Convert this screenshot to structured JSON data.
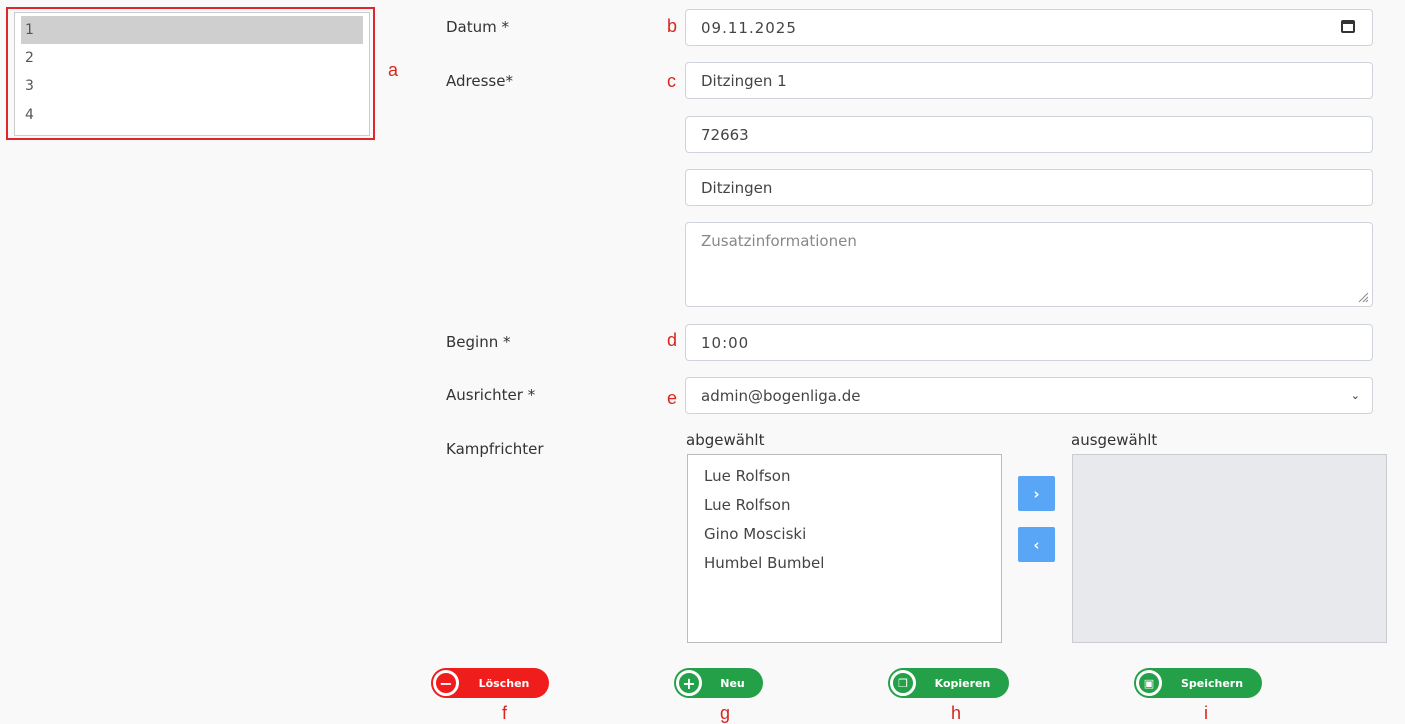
{
  "sidebar": {
    "items": [
      "1",
      "2",
      "3",
      "4"
    ],
    "selected_index": 0
  },
  "annotations": {
    "a": "a",
    "b": "b",
    "c": "c",
    "d": "d",
    "e": "e",
    "f": "f",
    "g": "g",
    "h": "h",
    "i": "i"
  },
  "form": {
    "datum_label": "Datum *",
    "datum_value": "09.11.2025",
    "adresse_label": "Adresse*",
    "street_value": "Ditzingen 1",
    "zip_value": "72663",
    "city_value": "Ditzingen",
    "zusatz_placeholder": "Zusatzinformationen",
    "beginn_label": "Beginn *",
    "beginn_value": "10:00",
    "ausrichter_label": "Ausrichter *",
    "ausrichter_value": "admin@bogenliga.de",
    "kampfrichter_label": "Kampfrichter",
    "abgewaehlt_label": "abgewählt",
    "ausgewaehlt_label": "ausgewählt",
    "abgewaehlt_items": [
      "Lue Rolfson",
      "Lue Rolfson",
      "Gino Mosciski",
      "Humbel Bumbel"
    ],
    "move_right_icon": "chevron-right-icon",
    "move_left_icon": "chevron-left-icon"
  },
  "actions": {
    "delete_label": "Löschen",
    "new_label": "Neu",
    "copy_label": "Kopieren",
    "save_label": "Speichern"
  },
  "colors": {
    "accent_red": "#f01d1d",
    "accent_green": "#24a148",
    "arrow_blue": "#58a6f5",
    "annotation_red": "#d7261e"
  }
}
